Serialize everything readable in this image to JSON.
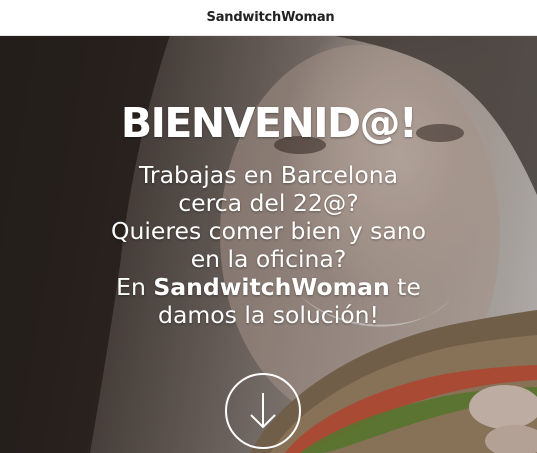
{
  "header": {
    "brand": "SandwitchWoman"
  },
  "hero": {
    "title": "BIENVENID@!",
    "lines": [
      "Trabajas en Barcelona",
      "cerca del 22@?",
      "Quieres comer bien y sano",
      "en la oficina?"
    ],
    "cta_prefix": "En",
    "cta_brand": "SandwitchWoman",
    "cta_suffix": "te",
    "last_line": "damos la solución!",
    "scroll_icon": "arrow-down-icon"
  },
  "colors": {
    "text": "#ffffff",
    "topbar": "#ffffff",
    "brand_text": "#222222"
  }
}
